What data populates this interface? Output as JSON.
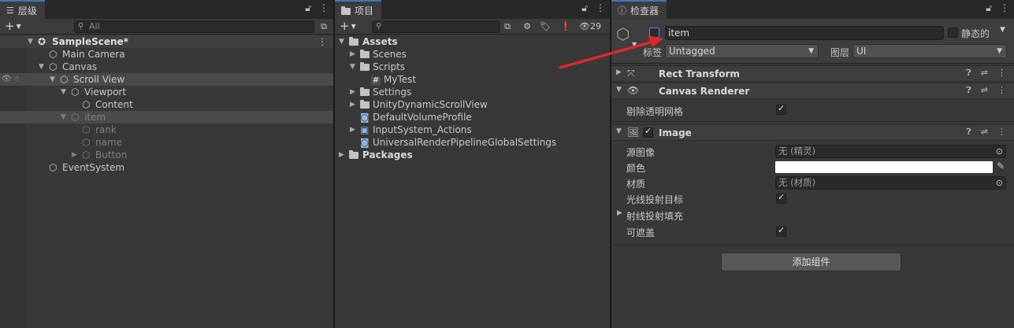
{
  "hierarchy": {
    "tab_label": "层级",
    "search_placeholder": "All",
    "items": [
      {
        "label": "SampleScene*"
      },
      {
        "label": "Main Camera"
      },
      {
        "label": "Canvas"
      },
      {
        "label": "Scroll View"
      },
      {
        "label": "Viewport"
      },
      {
        "label": "Content"
      },
      {
        "label": "item"
      },
      {
        "label": "rank"
      },
      {
        "label": "name"
      },
      {
        "label": "Button"
      },
      {
        "label": "EventSystem"
      }
    ]
  },
  "project": {
    "tab_label": "项目",
    "hidden_count": "29",
    "items": [
      {
        "label": "Assets"
      },
      {
        "label": "Scenes"
      },
      {
        "label": "Scripts"
      },
      {
        "label": "MyTest"
      },
      {
        "label": "Settings"
      },
      {
        "label": "UnityDynamicScrollView"
      },
      {
        "label": "DefaultVolumeProfile"
      },
      {
        "label": "InputSystem_Actions"
      },
      {
        "label": "UniversalRenderPipelineGlobalSettings"
      },
      {
        "label": "Packages"
      }
    ]
  },
  "inspector": {
    "tab_label": "检查器",
    "object_name": "item",
    "static_label": "静态的",
    "tag_label": "标签",
    "tag_value": "Untagged",
    "layer_label": "图层",
    "layer_value": "UI",
    "components": {
      "rect_transform": "Rect Transform",
      "canvas_renderer": "Canvas Renderer",
      "image": "Image"
    },
    "canvas_renderer_props": {
      "cull_transparent": "剔除透明网格"
    },
    "image_props": {
      "source_image_label": "源图像",
      "source_image_value": "无 (精灵)",
      "color_label": "颜色",
      "material_label": "材质",
      "material_value": "无 (材质)",
      "raycast_target_label": "光线投射目标",
      "raycast_padding_label": "射线投射填充",
      "maskable_label": "可遮盖"
    },
    "add_component_label": "添加组件"
  },
  "colors": {
    "arrow": "#e0282b",
    "accent": "#3a79bb"
  }
}
